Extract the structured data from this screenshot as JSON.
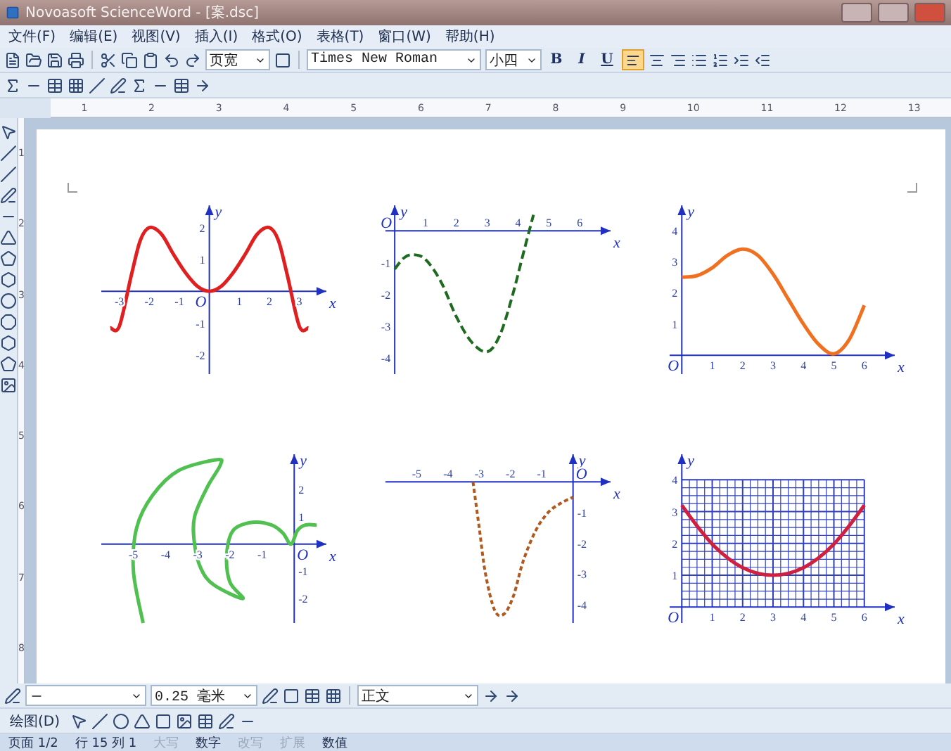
{
  "window": {
    "title": "Novoasoft ScienceWord - [案.dsc]"
  },
  "menu": [
    "文件(F)",
    "编辑(E)",
    "视图(V)",
    "插入(I)",
    "格式(O)",
    "表格(T)",
    "窗口(W)",
    "帮助(H)"
  ],
  "toolbar": {
    "zoom": "页宽",
    "font": "Times New Roman",
    "size": "小四",
    "bold": "B",
    "italic": "I",
    "underline": "U",
    "bold_on": false,
    "highlight_on": true
  },
  "ruler": {
    "h": [
      "1",
      "2",
      "3",
      "4",
      "5",
      "6",
      "7",
      "8",
      "9",
      "10",
      "11",
      "12",
      "13"
    ],
    "v": [
      "1",
      "2",
      "3",
      "4",
      "5",
      "6",
      "7",
      "8"
    ]
  },
  "charts": [
    {
      "chart_data": {
        "type": "line",
        "xlabel": "x",
        "ylabel": "y",
        "annotations": [
          "O"
        ],
        "xlim": [
          -3.6,
          3.9
        ],
        "ylim": [
          -2.6,
          2.7
        ],
        "xticks": [
          -3,
          -2,
          -1,
          1,
          2,
          3
        ],
        "yticks": [
          -2,
          -1,
          1,
          2
        ],
        "x": [
          -3.3,
          -3,
          -2.6,
          -2.3,
          -2,
          -1.6,
          -1.2,
          -0.8,
          -0.4,
          0,
          0.4,
          0.8,
          1.2,
          1.6,
          2,
          2.3,
          2.6,
          3,
          3.3
        ],
        "series": [
          {
            "color": "#e02020",
            "line_style": "solid",
            "values": [
              -1.15,
              -1.1,
              0.5,
              1.6,
              2,
              1.8,
              1.17,
              0.59,
              0.16,
              0,
              0.16,
              0.59,
              1.17,
              1.8,
              2,
              1.6,
              0.5,
              -1.1,
              -1.15
            ]
          }
        ]
      }
    },
    {
      "chart_data": {
        "type": "line",
        "xlabel": "x",
        "ylabel": "y",
        "annotations": [
          "O"
        ],
        "xlim": [
          -0.3,
          7
        ],
        "ylim": [
          -4.5,
          0.8
        ],
        "xticks": [
          1,
          2,
          3,
          4,
          5,
          6
        ],
        "yticks": [
          -1,
          -2,
          -3,
          -4
        ],
        "x": [
          0,
          0.3,
          0.6,
          1,
          1.5,
          2,
          2.5,
          3,
          3.4,
          3.8,
          4.2,
          4.5
        ],
        "series": [
          {
            "color": "#1e6a1e",
            "line_style": "dashed",
            "values": [
              -1.2,
              -0.85,
              -0.75,
              -0.9,
              -1.6,
              -2.7,
              -3.5,
              -3.8,
              -3.3,
              -2.1,
              -0.6,
              0.5
            ]
          }
        ]
      }
    },
    {
      "chart_data": {
        "type": "line",
        "xlabel": "x",
        "ylabel": "y",
        "annotations": [
          "O"
        ],
        "xlim": [
          -0.4,
          7
        ],
        "ylim": [
          -0.6,
          4.8
        ],
        "xticks": [
          1,
          2,
          3,
          4,
          5,
          6
        ],
        "yticks": [
          1,
          2,
          3,
          4
        ],
        "x": [
          0,
          0.5,
          1,
          1.5,
          2,
          2.5,
          3,
          3.5,
          4,
          4.5,
          5,
          5.5,
          6
        ],
        "series": [
          {
            "color": "#f07020",
            "line_style": "solid",
            "values": [
              2.5,
              2.55,
              2.8,
              3.2,
              3.4,
              3.2,
              2.6,
              1.8,
              1,
              0.35,
              0.05,
              0.5,
              1.6
            ]
          }
        ]
      }
    },
    {
      "chart_data": {
        "type": "line",
        "xlabel": "x",
        "ylabel": "y",
        "annotations": [
          "O"
        ],
        "xlim": [
          -6,
          1
        ],
        "ylim": [
          -2.9,
          3.3
        ],
        "xticks": [
          -5,
          -4,
          -3,
          -2,
          -1
        ],
        "yticks": [
          -2,
          -1,
          1,
          2
        ],
        "x": [
          -4.7,
          -5,
          -4.9,
          -4.4,
          -3.6,
          -2.4,
          -2.3,
          -2.7,
          -3.1,
          -3.1,
          -2.9,
          -2.5,
          -1.6,
          -2,
          -2.1,
          -1.9,
          -1.3,
          -0.7,
          -0.35,
          -0.1,
          0.1,
          0.35,
          0.7
        ],
        "series": [
          {
            "color": "#50c050",
            "line_style": "solid",
            "values": [
              -2.9,
              -1,
              0.6,
              1.8,
              2.7,
              3.1,
              2.9,
              2.1,
              1,
              0,
              -0.9,
              -1.5,
              -2,
              -1.4,
              -0.4,
              0.5,
              0.8,
              0.7,
              0.4,
              0,
              0.5,
              0.7,
              0.7
            ]
          }
        ]
      }
    },
    {
      "chart_data": {
        "type": "line",
        "xlabel": "x",
        "ylabel": "y",
        "annotations": [
          "O"
        ],
        "xlim": [
          -6,
          1.2
        ],
        "ylim": [
          -4.6,
          0.9
        ],
        "xticks": [
          -5,
          -4,
          -3,
          -2,
          -1
        ],
        "yticks": [
          -1,
          -2,
          -3,
          -4
        ],
        "x": [
          -3.2,
          -3,
          -2.8,
          -2.5,
          -2.2,
          -1.9,
          -1.6,
          -1.2,
          -0.8,
          -0.4,
          0
        ],
        "series": [
          {
            "color": "#b05a20",
            "line_style": "dashed",
            "values": [
              0,
              -1.5,
              -3,
              -4.2,
              -4.3,
              -3.7,
              -2.6,
              -1.6,
              -1,
              -0.7,
              -0.5
            ]
          }
        ]
      }
    },
    {
      "chart_data": {
        "type": "line",
        "xlabel": "x",
        "ylabel": "y",
        "annotations": [
          "O"
        ],
        "grid": true,
        "ref_lines": [
          {
            "axis": "x",
            "value": 0.25
          },
          {
            "axis": "x",
            "value": 0.5
          },
          {
            "axis": "x",
            "value": 0.75
          },
          {
            "axis": "x",
            "value": 1.25
          },
          {
            "axis": "x",
            "value": 1.5
          },
          {
            "axis": "x",
            "value": 1.75
          },
          {
            "axis": "x",
            "value": 2.25
          },
          {
            "axis": "x",
            "value": 2.5
          },
          {
            "axis": "x",
            "value": 2.75
          },
          {
            "axis": "x",
            "value": 3.25
          },
          {
            "axis": "x",
            "value": 3.5
          },
          {
            "axis": "x",
            "value": 3.75
          },
          {
            "axis": "x",
            "value": 4.25
          },
          {
            "axis": "x",
            "value": 4.5
          },
          {
            "axis": "x",
            "value": 4.75
          },
          {
            "axis": "x",
            "value": 5.25
          },
          {
            "axis": "x",
            "value": 5.5
          },
          {
            "axis": "x",
            "value": 5.75
          },
          {
            "axis": "y",
            "value": 0.25
          },
          {
            "axis": "y",
            "value": 0.5
          },
          {
            "axis": "y",
            "value": 0.75
          },
          {
            "axis": "y",
            "value": 1.25
          },
          {
            "axis": "y",
            "value": 1.5
          },
          {
            "axis": "y",
            "value": 1.75
          },
          {
            "axis": "y",
            "value": 2.25
          },
          {
            "axis": "y",
            "value": 2.5
          },
          {
            "axis": "y",
            "value": 2.75
          },
          {
            "axis": "y",
            "value": 3.25
          },
          {
            "axis": "y",
            "value": 3.5
          },
          {
            "axis": "y",
            "value": 3.75
          }
        ],
        "xlim": [
          -0.4,
          7
        ],
        "ylim": [
          -0.5,
          4.8
        ],
        "xticks": [
          1,
          2,
          3,
          4,
          5,
          6
        ],
        "yticks": [
          1,
          2,
          3,
          4
        ],
        "x": [
          0,
          0.5,
          1,
          1.5,
          2,
          2.5,
          3,
          3.5,
          4,
          4.5,
          5,
          5.5,
          6
        ],
        "series": [
          {
            "color": "#d02040",
            "line_style": "solid",
            "values": [
              3.2,
              2.55,
              1.98,
              1.55,
              1.24,
              1.06,
              1,
              1.06,
              1.24,
              1.55,
              1.98,
              2.55,
              3.2
            ]
          }
        ]
      }
    }
  ],
  "bottom_toolbar": {
    "line_width": "0.25 毫米",
    "style": "正文",
    "draw_menu": "绘图(D)"
  },
  "status_bar": [
    {
      "text": "页面 1/2",
      "disabled": false
    },
    {
      "text": "行 15 列 1",
      "disabled": false
    },
    {
      "text": "大写",
      "disabled": true
    },
    {
      "text": "数字",
      "disabled": false
    },
    {
      "text": "改写",
      "disabled": true
    },
    {
      "text": "扩展",
      "disabled": true
    },
    {
      "text": "数值",
      "disabled": false
    }
  ]
}
